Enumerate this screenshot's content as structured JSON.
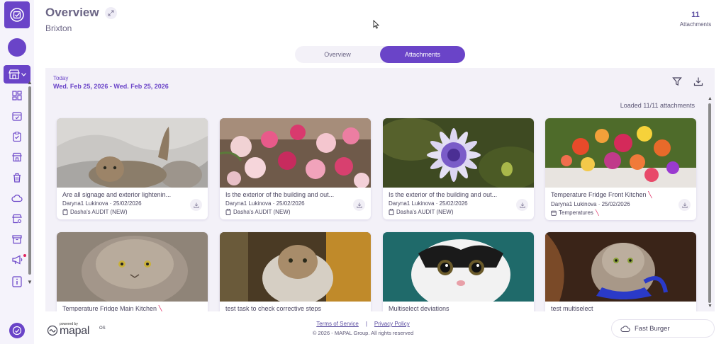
{
  "header": {
    "title": "Overview",
    "subtitle": "Brixton",
    "attachments_count": "11",
    "attachments_label": "Attachments"
  },
  "tabs": [
    {
      "label": "Overview",
      "active": false
    },
    {
      "label": "Attachments",
      "active": true
    }
  ],
  "filter": {
    "period_label": "Today",
    "date_range": "Wed. Feb 25, 2026 - Wed. Feb 25, 2026"
  },
  "loaded_text": "Loaded 11/11 attachments",
  "cards": [
    {
      "title": "Are all signage and exterior lightenin...",
      "author_date": "Daryna1 Lukinova · 25/02/2026",
      "source": "Dasha's AUDIT (NEW)",
      "source_icon": "clipboard-icon",
      "flag": false
    },
    {
      "title": "Is the exterior of the building and out...",
      "author_date": "Daryna1 Lukinova · 25/02/2026",
      "source": "Dasha's AUDIT (NEW)",
      "source_icon": "clipboard-icon",
      "flag": false
    },
    {
      "title": "Is the exterior of the building and out...",
      "author_date": "Daryna1 Lukinova · 25/02/2026",
      "source": "Dasha's AUDIT (NEW)",
      "source_icon": "clipboard-icon",
      "flag": false
    },
    {
      "title": "Temperature Fridge Front Kitchen",
      "author_date": "Daryna1 Lukinova · 25/02/2026",
      "source": "Temperatures",
      "source_icon": "calendar-icon",
      "flag": true
    },
    {
      "title": "Temperature Fridge Main Kitchen",
      "author_date": "",
      "source": "",
      "source_icon": "",
      "flag": true
    },
    {
      "title": "test task to check corrective steps",
      "author_date": "",
      "source": "",
      "source_icon": "",
      "flag": false
    },
    {
      "title": "Multiselect deviations",
      "author_date": "",
      "source": "",
      "source_icon": "",
      "flag": false
    },
    {
      "title": "test multiselect",
      "author_date": "",
      "source": "",
      "source_icon": "",
      "flag": false
    }
  ],
  "footer": {
    "powered_by": "powered by",
    "brand": "mapal",
    "brand_suffix": "OS",
    "terms": "Terms of Service",
    "separator": "|",
    "privacy": "Privacy Policy",
    "copyright": "© 2026 - MAPAL Group. All rights reserved",
    "site": "Fast Burger"
  },
  "colors": {
    "accent": "#6a44c8",
    "panel": "#f3f1f8",
    "flag": "#e0245e"
  }
}
